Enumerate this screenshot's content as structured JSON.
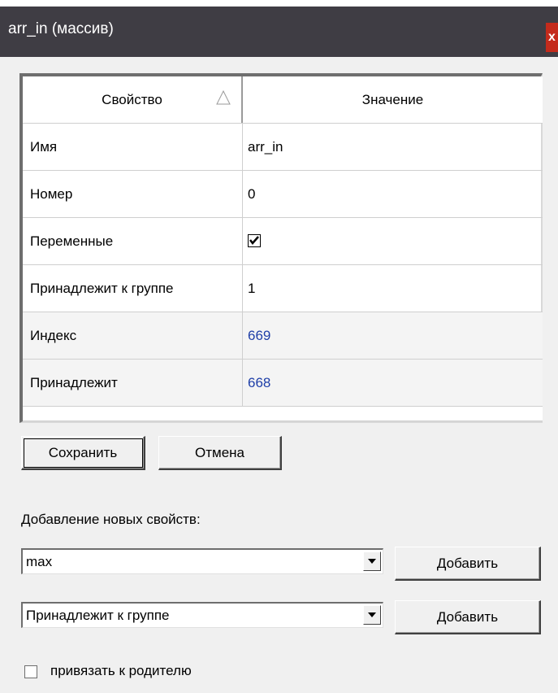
{
  "window": {
    "title": "arr_in (массив)",
    "close_label": "x"
  },
  "grid": {
    "headers": {
      "property": "Свойство",
      "value": "Значение"
    },
    "rows": [
      {
        "property": "Имя",
        "value": "arr_in"
      },
      {
        "property": "Номер",
        "value": "0"
      },
      {
        "property": "Переменные",
        "value": "",
        "checked": true
      },
      {
        "property": "Принадлежит к группе",
        "value": "1"
      },
      {
        "property": "Индекс",
        "value": "669",
        "readonly": true
      },
      {
        "property": "Принадлежит",
        "value": "668",
        "readonly": true
      }
    ]
  },
  "buttons": {
    "save": "Сохранить",
    "cancel": "Отмена"
  },
  "add_section": {
    "label": "Добавление новых свойств:",
    "combo1_value": "max",
    "combo2_value": "Принадлежит к группе",
    "add_label": "Добавить",
    "add_label_2": "Добавить"
  },
  "bind_parent": {
    "label": "привязать к родителю",
    "checked": false
  },
  "colors": {
    "titlebar": "#3f3d44",
    "close": "#c42b1c",
    "link": "#1f3fa8",
    "client": "#f0f0f0"
  },
  "icons": {
    "sort": "sort-ascending-icon",
    "dropdown": "chevron-down-icon",
    "check": "checkmark-icon"
  }
}
